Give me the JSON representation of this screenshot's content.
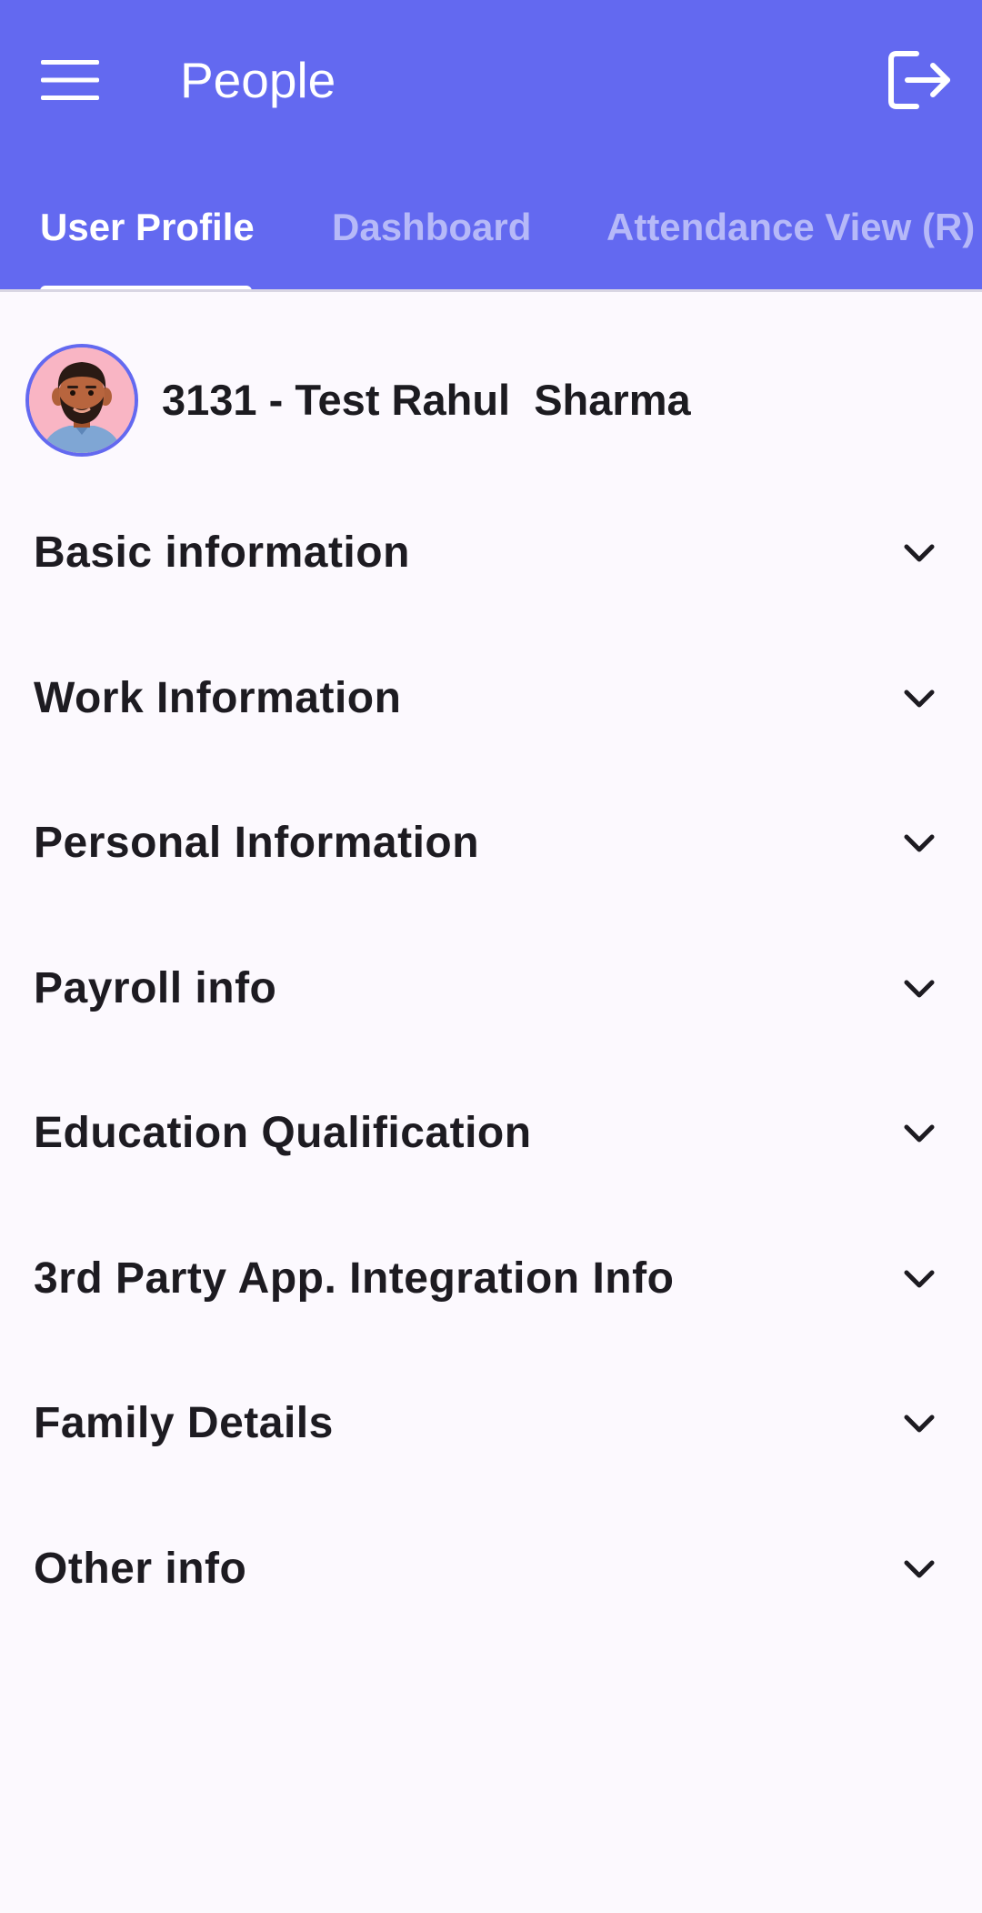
{
  "colors": {
    "app_bar": "#6369f0",
    "tab_active": "#ffffff",
    "tab_inactive": "#b6b9f8",
    "background": "#fcf9fe",
    "text_primary": "#1d1b21"
  },
  "toolbar": {
    "menu_icon": "hamburger-menu-icon",
    "title": "People",
    "logout_icon": "logout-icon"
  },
  "tabs": [
    {
      "label": "User Profile",
      "active": true
    },
    {
      "label": "Dashboard",
      "active": false
    },
    {
      "label": "Attendance View (R)",
      "active": false
    }
  ],
  "profile": {
    "avatar_icon": "user-avatar-icon",
    "name": "3131 - Test Rahul  Sharma"
  },
  "sections": [
    {
      "label": "Basic information",
      "icon": "chevron-down-icon"
    },
    {
      "label": "Work Information",
      "icon": "chevron-down-icon"
    },
    {
      "label": "Personal Information",
      "icon": "chevron-down-icon"
    },
    {
      "label": "Payroll info",
      "icon": "chevron-down-icon"
    },
    {
      "label": "Education Qualification",
      "icon": "chevron-down-icon"
    },
    {
      "label": "3rd Party App. Integration Info",
      "icon": "chevron-down-icon"
    },
    {
      "label": "Family Details",
      "icon": "chevron-down-icon"
    },
    {
      "label": "Other info",
      "icon": "chevron-down-icon"
    }
  ]
}
